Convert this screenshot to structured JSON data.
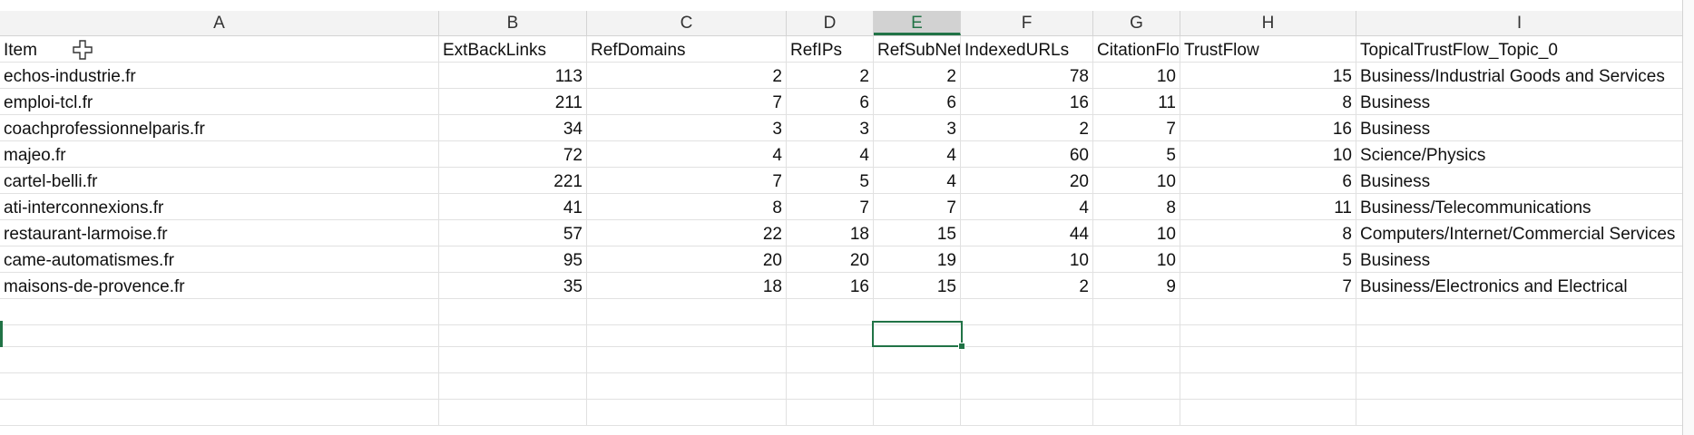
{
  "columns": [
    "A",
    "B",
    "C",
    "D",
    "E",
    "F",
    "G",
    "H",
    "I"
  ],
  "headers": [
    "Item",
    "ExtBackLinks",
    "RefDomains",
    "RefIPs",
    "RefSubNets",
    "IndexedURLs",
    "CitationFlow",
    "TrustFlow",
    "TopicalTrustFlow_Topic_0"
  ],
  "rows": [
    [
      "echos-industrie.fr",
      "113",
      "2",
      "2",
      "2",
      "78",
      "10",
      "15",
      "Business/Industrial Goods and Services"
    ],
    [
      "emploi-tcl.fr",
      "211",
      "7",
      "6",
      "6",
      "16",
      "11",
      "8",
      "Business"
    ],
    [
      "coachprofessionnelparis.fr",
      "34",
      "3",
      "3",
      "3",
      "2",
      "7",
      "16",
      "Business"
    ],
    [
      "majeo.fr",
      "72",
      "4",
      "4",
      "4",
      "60",
      "5",
      "10",
      "Science/Physics"
    ],
    [
      "cartel-belli.fr",
      "221",
      "7",
      "5",
      "4",
      "20",
      "10",
      "6",
      "Business"
    ],
    [
      "ati-interconnexions.fr",
      "41",
      "8",
      "7",
      "7",
      "4",
      "8",
      "11",
      "Business/Telecommunications"
    ],
    [
      "restaurant-larmoise.fr",
      "57",
      "22",
      "18",
      "15",
      "44",
      "10",
      "8",
      "Computers/Internet/Commercial Services"
    ],
    [
      "came-automatismes.fr",
      "95",
      "20",
      "20",
      "19",
      "10",
      "10",
      "5",
      "Business"
    ],
    [
      "maisons-de-provence.fr",
      "35",
      "18",
      "16",
      "15",
      "2",
      "9",
      "7",
      "Business/Electronics and Electrical"
    ]
  ],
  "active_column": "E",
  "colors": {
    "accent": "#217346",
    "grid": "#e1e1e1",
    "header_bg": "#f3f3f3"
  },
  "icons": {
    "cursor": "move-cursor-icon"
  }
}
